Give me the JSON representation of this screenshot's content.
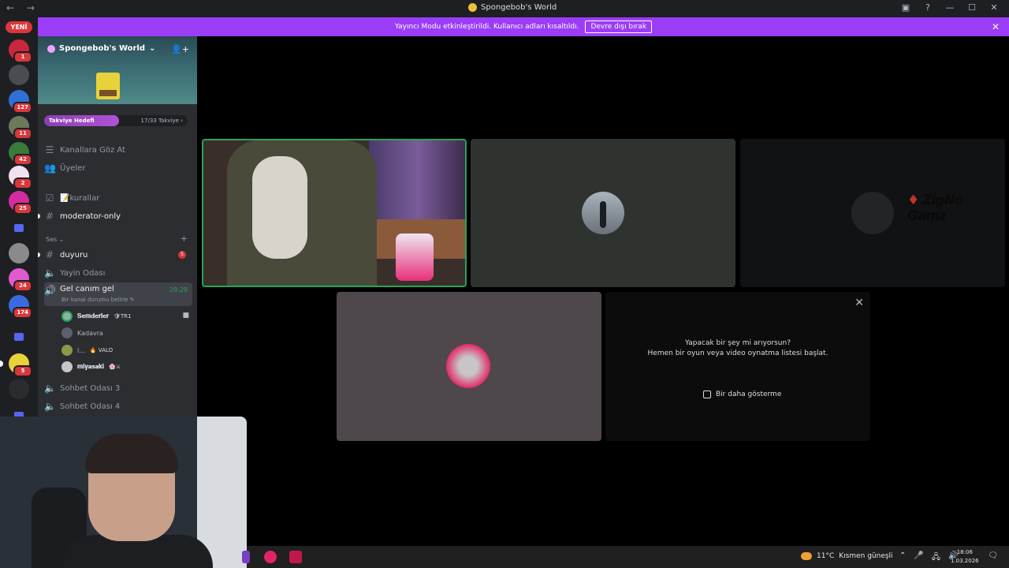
{
  "window": {
    "title": "Spongebob's World",
    "nav_arrows": "← →",
    "controls": [
      "▣",
      "?",
      "—",
      "☐",
      "✕"
    ]
  },
  "banner": {
    "text": "Yayıncı Modu etkinleştirildi. Kullanıcı adları kısaltıldı.",
    "button": "Devre dışı bırak",
    "close": "✕"
  },
  "serverbar": {
    "new_pill": "YENİ",
    "badges": [
      "1",
      "127",
      "11",
      "42",
      "2",
      "25",
      "24",
      "174",
      "5"
    ]
  },
  "server": {
    "name": "Spongebob's World",
    "dropdown": "⌄",
    "invite_icon": "👤+",
    "boost_label": "Takviye Hedefi",
    "boost_count": "17/33 Takviye",
    "boost_chevron": "›",
    "boost_progress": 0.52
  },
  "sidebar": {
    "browse_channels": "Kanallara Göz At",
    "members": "Üyeler",
    "rules": "📝kurallar",
    "moderator": "moderator-only",
    "voice_section": "Ses ⌄",
    "add": "+",
    "announcements": "duyuru",
    "announcements_badge": "5",
    "stream_room": "Yayin Odası",
    "active_voice": "Gel canım gel",
    "active_voice_time": "29:29",
    "active_voice_status": "Bir kanal durumu belirle ✎",
    "chat3": "Sohbet Odası 3",
    "chat4": "Sohbet Odası 4"
  },
  "voice_users": [
    {
      "name": "𝐒𝐞𝐦𝐝𝐞𝐫𝐥𝐞𝐫",
      "tag": "🛡TR1"
    },
    {
      "name": "Kadavra",
      "tag": ""
    },
    {
      "name": "l...",
      "tag": "🔥 VALO"
    },
    {
      "name": "𝐦𝐢𝐲𝐚𝐬𝐚𝐤𝐢",
      "tag": "🌸⚔"
    }
  ],
  "activity_panel": {
    "close": "✕",
    "line1": "Yapacak bir şey mi arıyorsun?",
    "line2": "Hemen bir oyun veya video oynatma listesi başlat.",
    "checkbox_label": "Bir daha gösterme"
  },
  "watermark": "ZigNo Gamz",
  "taskbar": {
    "weather_temp": "11°C",
    "weather_text": "Kısmen güneşli",
    "tray": [
      "⌃",
      "🎤",
      "🖧",
      "🔊"
    ],
    "time": "18:06",
    "date": "1.03.2026",
    "notification": "🗨"
  },
  "colors": {
    "banner": "#9b3df7",
    "speaking": "#23a559",
    "badge": "#da373c"
  }
}
